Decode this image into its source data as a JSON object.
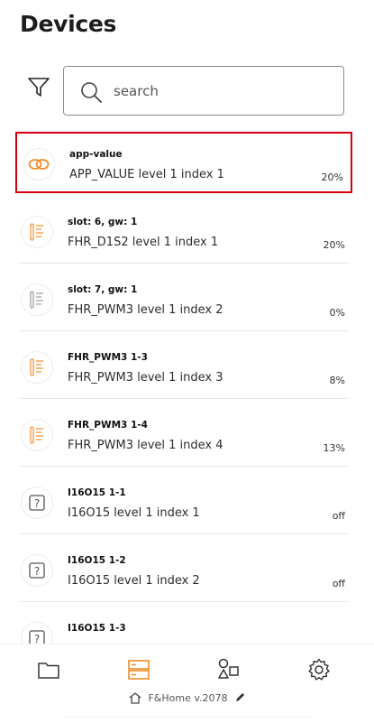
{
  "header": {
    "title": "Devices"
  },
  "search": {
    "placeholder": "search"
  },
  "devices": [
    {
      "name": "app-value",
      "desc": "APP_VALUE level 1 index 1",
      "value": "20%",
      "icon": "link-rings-icon"
    },
    {
      "name": "slot: 6, gw: 1",
      "desc": "FHR_D1S2 level 1 index 1",
      "value": "20%",
      "icon": "radiator-icon"
    },
    {
      "name": "slot: 7, gw: 1",
      "desc": "FHR_PWM3 level 1 index 2",
      "value": "0%",
      "icon": "radiator-icon"
    },
    {
      "name": "FHR_PWM3 1-3",
      "desc": "FHR_PWM3 level 1 index 3",
      "value": "8%",
      "icon": "radiator-icon"
    },
    {
      "name": "FHR_PWM3 1-4",
      "desc": "FHR_PWM3 level 1 index 4",
      "value": "13%",
      "icon": "radiator-icon"
    },
    {
      "name": "I16O15 1-1",
      "desc": "I16O15 level 1 index 1",
      "value": "off",
      "icon": "question-box-icon"
    },
    {
      "name": "I16O15 1-2",
      "desc": "I16O15 level 1 index 2",
      "value": "off",
      "icon": "question-box-icon"
    },
    {
      "name": "I16O15 1-3",
      "desc": "",
      "value": "",
      "icon": "question-box-icon"
    }
  ],
  "footer": {
    "version": "F&Home v.2078"
  },
  "colors": {
    "accent": "#f28c28",
    "selected_border": "#d5000f"
  }
}
